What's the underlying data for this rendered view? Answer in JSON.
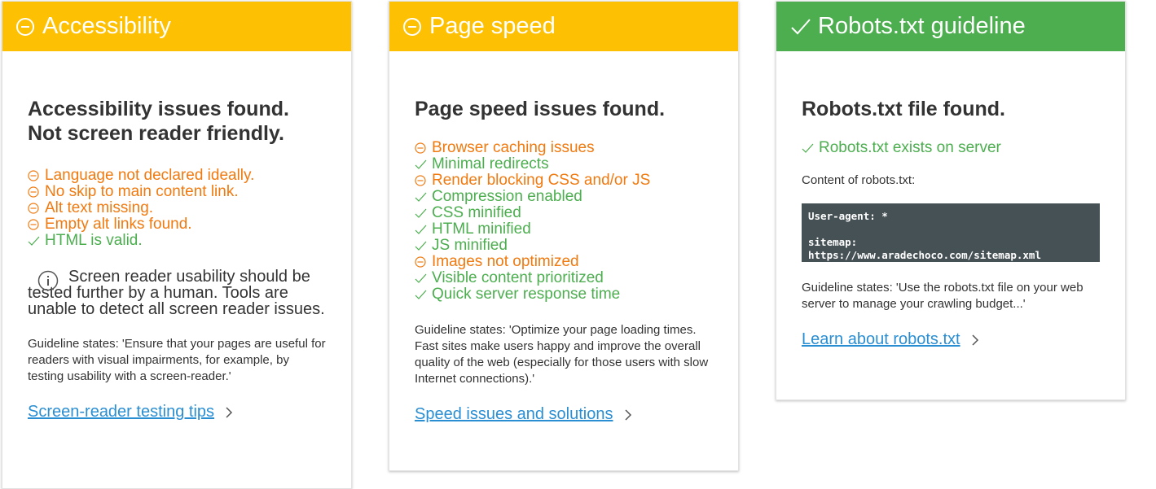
{
  "colors": {
    "warning_header": "#fdc002",
    "success_header": "#4cae4f",
    "bad_item": "#f07a10",
    "good_item": "#4cae4f",
    "link": "#2a8ed2",
    "code_bg": "#465156"
  },
  "accessibility": {
    "header_title": "Accessibility",
    "header_icon": "minus-circle-icon",
    "title_line1": "Accessibility issues found.",
    "title_line2": "Not screen reader friendly.",
    "items": [
      {
        "status": "bad",
        "text": "Language not declared ideally."
      },
      {
        "status": "bad",
        "text": "No skip to main content link."
      },
      {
        "status": "bad",
        "text": "Alt text missing."
      },
      {
        "status": "bad",
        "text": "Empty alt links found."
      },
      {
        "status": "good",
        "text": "HTML is valid."
      }
    ],
    "note": "Screen reader usability should be tested further by a human. Tools are unable to detect all screen reader issues.",
    "guideline": "Guideline states: 'Ensure that your pages are useful for readers with visual impairments, for example, by testing usability with a screen-reader.'",
    "link": "Screen-reader testing tips"
  },
  "pagespeed": {
    "header_title": "Page speed",
    "header_icon": "minus-circle-icon",
    "title": "Page speed issues found.",
    "items": [
      {
        "status": "bad",
        "text": "Browser caching issues"
      },
      {
        "status": "good",
        "text": "Minimal redirects"
      },
      {
        "status": "bad",
        "text": "Render blocking CSS and/or JS"
      },
      {
        "status": "good",
        "text": "Compression enabled"
      },
      {
        "status": "good",
        "text": "CSS minified"
      },
      {
        "status": "good",
        "text": "HTML minified"
      },
      {
        "status": "good",
        "text": "JS minified"
      },
      {
        "status": "bad",
        "text": "Images not optimized"
      },
      {
        "status": "good",
        "text": "Visible content prioritized"
      },
      {
        "status": "good",
        "text": "Quick server response time"
      }
    ],
    "guideline": "Guideline states: 'Optimize your page loading times. Fast sites make users happy and improve the overall quality of the web (especially for those users with slow Internet connections).'",
    "link": "Speed issues and solutions"
  },
  "robots": {
    "header_title": "Robots.txt guideline",
    "header_icon": "check-icon",
    "title": "Robots.txt file found.",
    "items": [
      {
        "status": "good",
        "text": "Robots.txt exists on server"
      }
    ],
    "content_label": "Content of robots.txt:",
    "code": "User-agent: *\n\nsitemap:\nhttps://www.aradechoco.com/sitemap.xml",
    "guideline": "Guideline states: 'Use the robots.txt file on your web server to manage your crawling budget...'",
    "link": "Learn about robots.txt"
  }
}
